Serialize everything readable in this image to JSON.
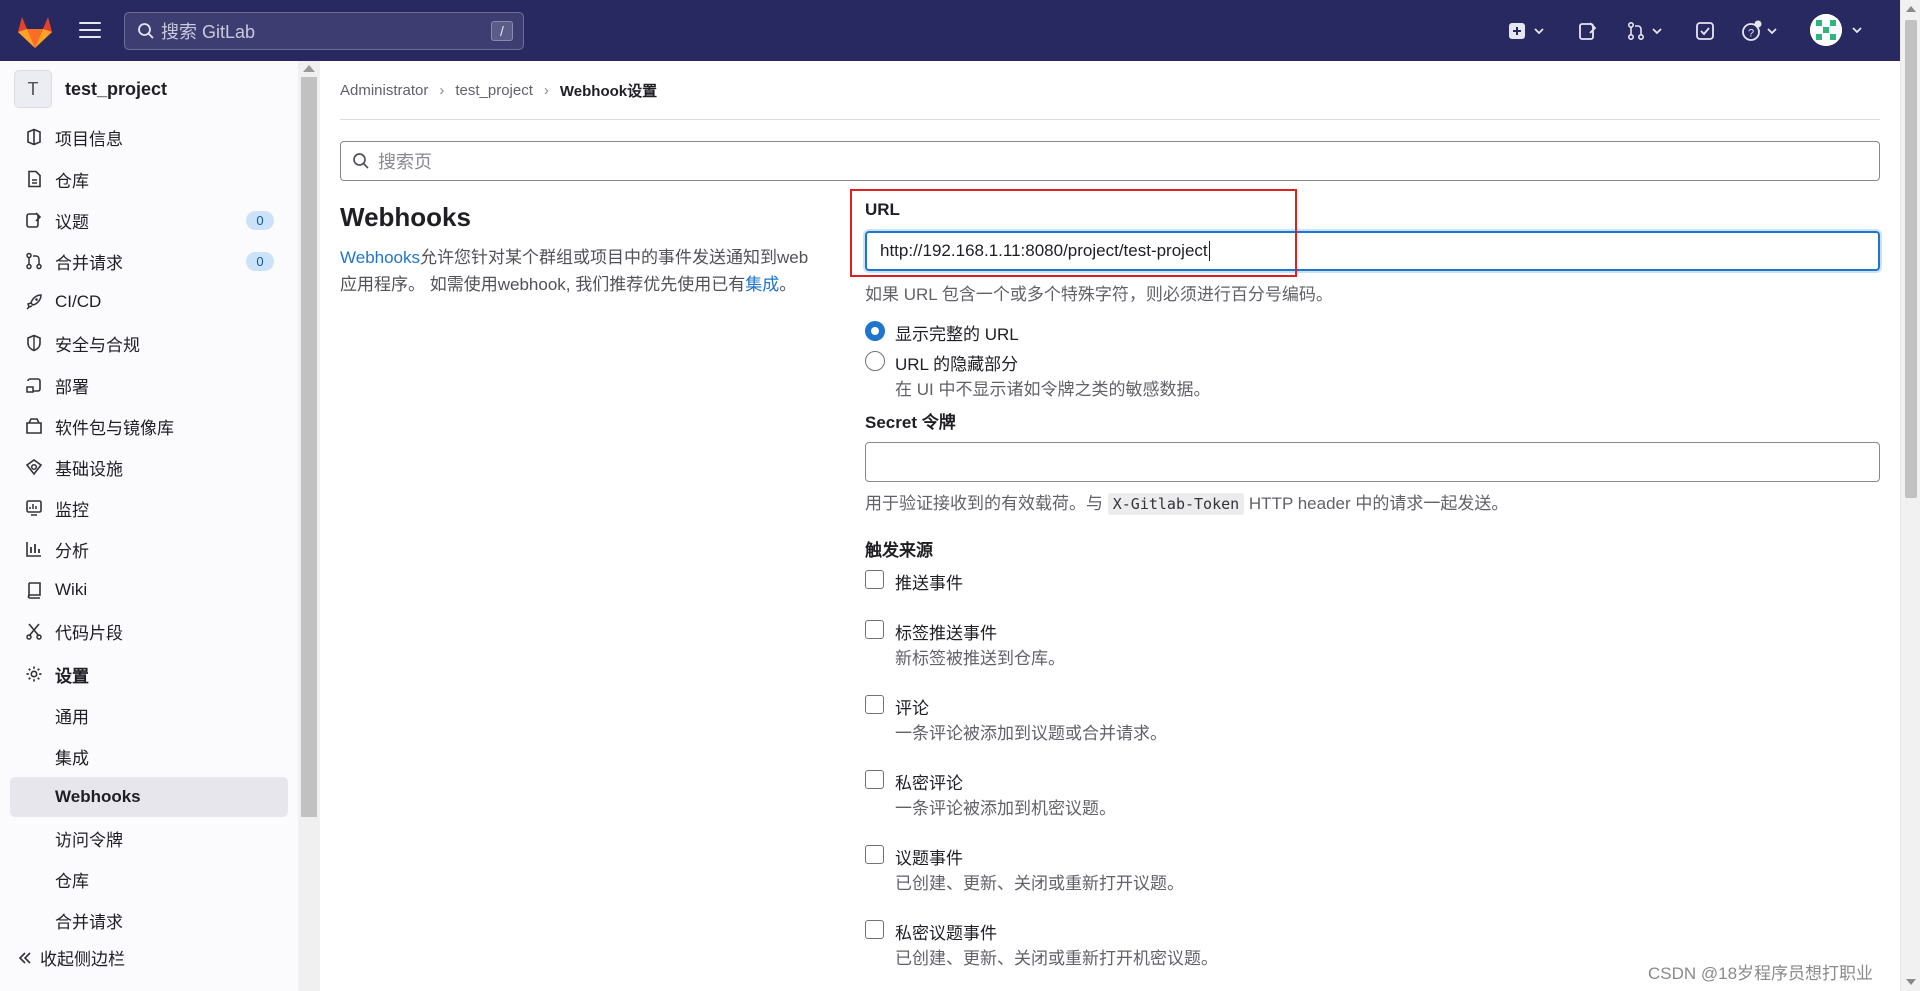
{
  "topbar": {
    "search_placeholder": "搜索 GitLab",
    "search_shortcut": "/"
  },
  "project": {
    "initial": "T",
    "name": "test_project"
  },
  "sidebar": {
    "items": [
      {
        "label": "项目信息",
        "icon": "project-info-icon"
      },
      {
        "label": "仓库",
        "icon": "repository-icon"
      },
      {
        "label": "议题",
        "icon": "issues-icon",
        "badge": "0"
      },
      {
        "label": "合并请求",
        "icon": "merge-request-icon",
        "badge": "0"
      },
      {
        "label": "CI/CD",
        "icon": "rocket-icon"
      },
      {
        "label": "安全与合规",
        "icon": "shield-icon"
      },
      {
        "label": "部署",
        "icon": "deployments-icon"
      },
      {
        "label": "软件包与镜像库",
        "icon": "package-icon"
      },
      {
        "label": "基础设施",
        "icon": "cloud-gear-icon"
      },
      {
        "label": "监控",
        "icon": "monitor-icon"
      },
      {
        "label": "分析",
        "icon": "chart-icon"
      },
      {
        "label": "Wiki",
        "icon": "book-icon"
      },
      {
        "label": "代码片段",
        "icon": "snippet-icon"
      },
      {
        "label": "设置",
        "icon": "settings-icon"
      }
    ],
    "sub_items": [
      "通用",
      "集成",
      "Webhooks",
      "访问令牌",
      "仓库",
      "合并请求"
    ],
    "active_sub": "Webhooks",
    "collapse_label": "收起侧边栏"
  },
  "breadcrumb": {
    "items": [
      "Administrator",
      "test_project"
    ],
    "current": "Webhook设置"
  },
  "page_search_placeholder": "搜索页",
  "section": {
    "title": "Webhooks",
    "desc_link": "Webhooks",
    "desc_text": "允许您针对某个群组或项目中的事件发送通知到web应用程序。 如需使用webhook, 我们推荐优先使用已有",
    "desc_link2": "集成",
    "desc_end": "。"
  },
  "form": {
    "url_label": "URL",
    "url_value": "http://192.168.1.11:8080/project/test-project",
    "url_help": "如果 URL 包含一个或多个特殊字符，则必须进行百分号编码。",
    "radio_full": "显示完整的 URL",
    "radio_full_checked": true,
    "radio_hidden": "URL 的隐藏部分",
    "radio_hidden_help": "在 UI 中不显示诸如令牌之类的敏感数据。",
    "secret_label": "Secret 令牌",
    "secret_value": "",
    "secret_help_pre": "用于验证接收到的有效载荷。与",
    "secret_help_code": "X-Gitlab-Token",
    "secret_help_post": "HTTP header 中的请求一起发送。",
    "triggers_label": "触发来源",
    "triggers": [
      {
        "label": "推送事件",
        "help": "",
        "checked": false
      },
      {
        "label": "标签推送事件",
        "help": "新标签被推送到仓库。",
        "checked": false
      },
      {
        "label": "评论",
        "help": "一条评论被添加到议题或合并请求。",
        "checked": false
      },
      {
        "label": "私密评论",
        "help": "一条评论被添加到机密议题。",
        "checked": false
      },
      {
        "label": "议题事件",
        "help": "已创建、更新、关闭或重新打开议题。",
        "checked": false
      },
      {
        "label": "私密议题事件",
        "help": "已创建、更新、关闭或重新打开机密议题。",
        "checked": false
      }
    ]
  },
  "watermark": "CSDN @18岁程序员想打职业",
  "colors": {
    "topbar": "#292961",
    "accent": "#1f75cb",
    "highlight_box": "#e02020",
    "badge_bg": "#cbe2f9"
  }
}
